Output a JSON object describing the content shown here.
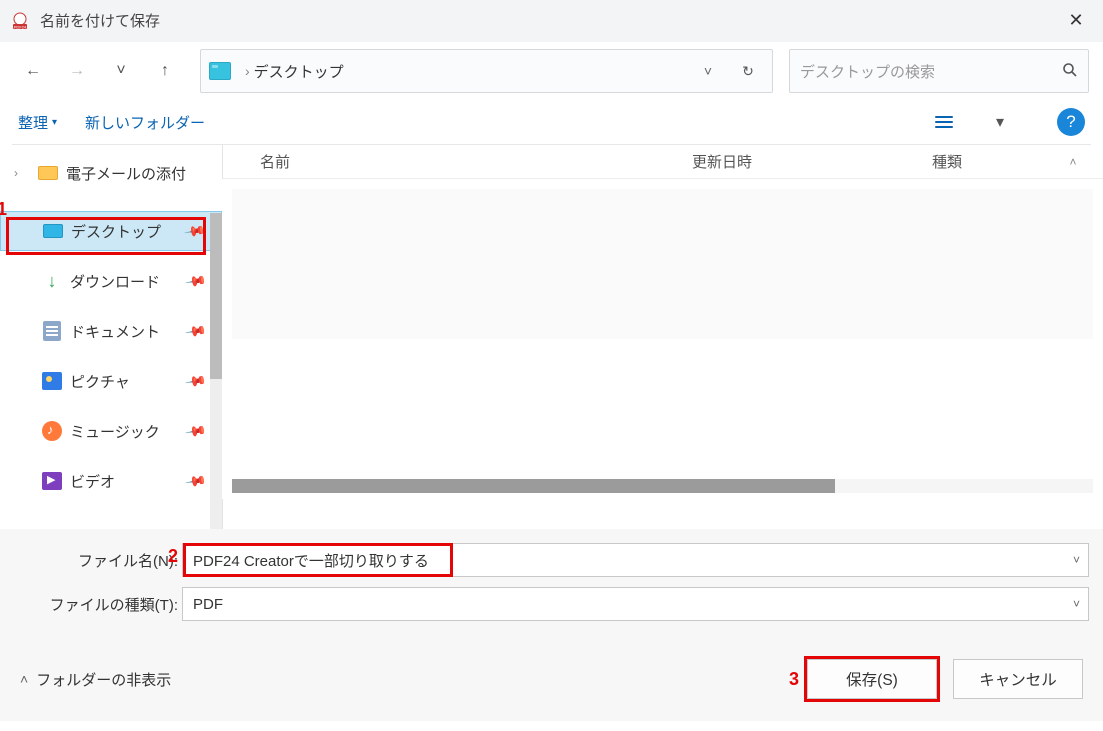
{
  "titlebar": {
    "title": "名前を付けて保存"
  },
  "nav": {
    "back": "←",
    "forward": "→",
    "recent": "˅",
    "up": "↑",
    "address_sep": "›",
    "address_location": "デスクトップ",
    "refresh": "↻",
    "search_placeholder": "デスクトップの検索"
  },
  "toolbar": {
    "organize": "整理",
    "new_folder": "新しいフォルダー",
    "view_dd": "▾",
    "help": "?"
  },
  "tree": {
    "top_item": "電子メールの添付",
    "items": [
      {
        "label": "デスクトップ",
        "icon": "desktop",
        "pinned": true,
        "selected": true
      },
      {
        "label": "ダウンロード",
        "icon": "download",
        "pinned": true
      },
      {
        "label": "ドキュメント",
        "icon": "doc",
        "pinned": true
      },
      {
        "label": "ピクチャ",
        "icon": "pic",
        "pinned": true
      },
      {
        "label": "ミュージック",
        "icon": "music",
        "pinned": true
      },
      {
        "label": "ビデオ",
        "icon": "video",
        "pinned": true
      }
    ]
  },
  "columns": {
    "name": "名前",
    "modified": "更新日時",
    "type": "種類",
    "sort": "˄"
  },
  "fields": {
    "filename_label": "ファイル名(N):",
    "filename_value": "PDF24 Creatorで一部切り取りする",
    "filetype_label": "ファイルの種類(T):",
    "filetype_value": "PDF"
  },
  "footer": {
    "hide_folders": "フォルダーの非表示",
    "save": "保存(S)",
    "cancel": "キャンセル"
  },
  "annotations": {
    "one": "1",
    "two": "2",
    "three": "3"
  }
}
